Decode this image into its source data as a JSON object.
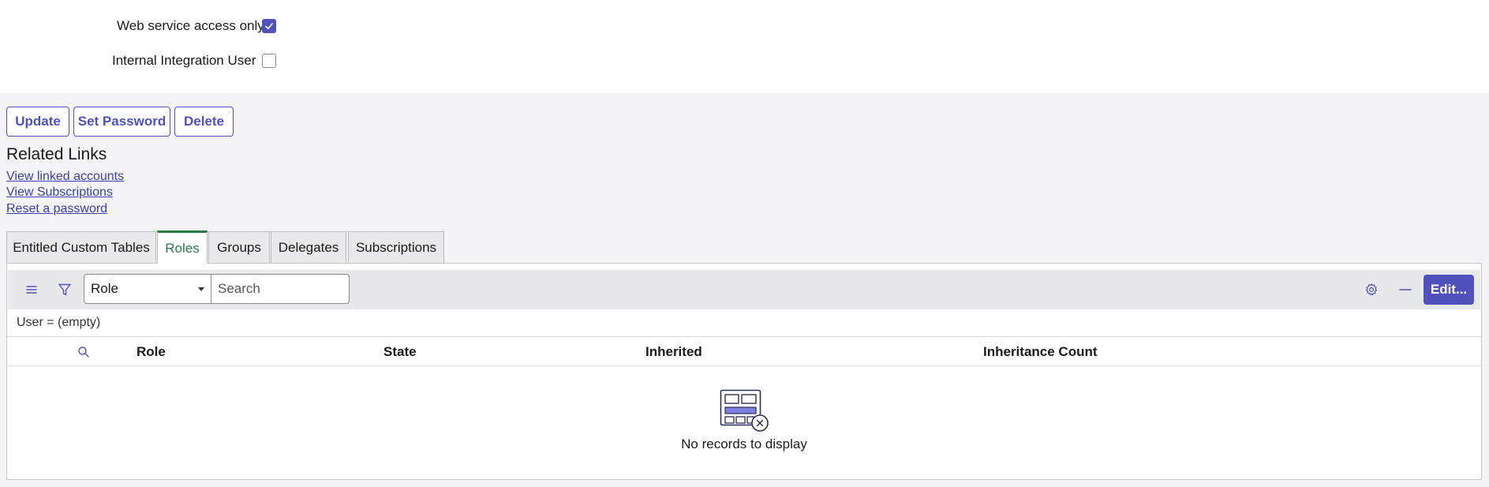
{
  "form": {
    "web_service_label": "Web service access only",
    "web_service_checked": true,
    "internal_integration_label": "Internal Integration User",
    "internal_integration_checked": false
  },
  "actions": {
    "update_label": "Update",
    "set_password_label": "Set Password",
    "delete_label": "Delete"
  },
  "related_links": {
    "title": "Related Links",
    "items": [
      {
        "label": "View linked accounts"
      },
      {
        "label": "View Subscriptions"
      },
      {
        "label": "Reset a password"
      }
    ]
  },
  "tabs": [
    {
      "label": "Entitled Custom Tables",
      "active": false
    },
    {
      "label": "Roles",
      "active": true
    },
    {
      "label": "Groups",
      "active": false
    },
    {
      "label": "Delegates",
      "active": false
    },
    {
      "label": "Subscriptions",
      "active": false
    }
  ],
  "list": {
    "toolbar": {
      "menu_icon": "hamburger-icon",
      "filter_icon": "funnel-icon",
      "search_field_value": "Role",
      "search_placeholder": "Search",
      "settings_icon": "gear-icon",
      "collapse_icon": "minus-icon",
      "edit_label": "Edit..."
    },
    "filter_breadcrumb": "User = (empty)",
    "columns": [
      {
        "label": "Role"
      },
      {
        "label": "State"
      },
      {
        "label": "Inherited"
      },
      {
        "label": "Inheritance Count"
      }
    ],
    "empty_message": "No records to display",
    "empty_icon": "empty-table-icon"
  },
  "colors": {
    "accent": "#4f52bd",
    "active_tab": "#2a7a46",
    "link": "#3b3fb0"
  }
}
